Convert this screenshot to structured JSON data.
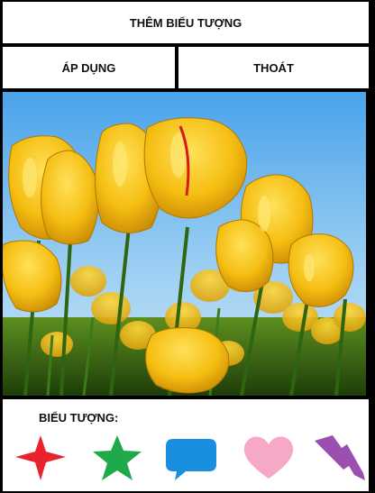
{
  "header": {
    "title": "THÊM BIỂU TƯỢNG"
  },
  "toolbar": {
    "apply_label": "ÁP DỤNG",
    "exit_label": "THOÁT"
  },
  "photo": {
    "subject": "yellow tulips under blue sky"
  },
  "stickers": {
    "label": "BIỂU TƯỢNG:",
    "items": [
      {
        "icon": "sparkle-star-icon",
        "color": "#e8232d"
      },
      {
        "icon": "star-icon",
        "color": "#1eaa4a"
      },
      {
        "icon": "speech-bubble-icon",
        "color": "#1a8fe0"
      },
      {
        "icon": "heart-icon",
        "color": "#f7a8c6"
      },
      {
        "icon": "lightning-icon",
        "color": "#9b4fb0"
      }
    ]
  }
}
